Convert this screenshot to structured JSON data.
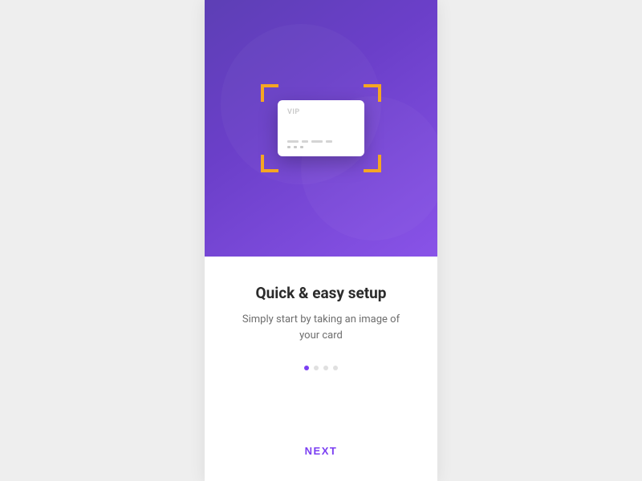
{
  "hero": {
    "card_label": "VIP"
  },
  "content": {
    "title": "Quick & easy setup",
    "subtitle": "Simply start by taking an image of your card"
  },
  "pagination": {
    "total": 4,
    "active": 0
  },
  "footer": {
    "next_label": "NEXT"
  },
  "colors": {
    "accent": "#7b3ff2",
    "scan_frame": "#f5a623"
  }
}
